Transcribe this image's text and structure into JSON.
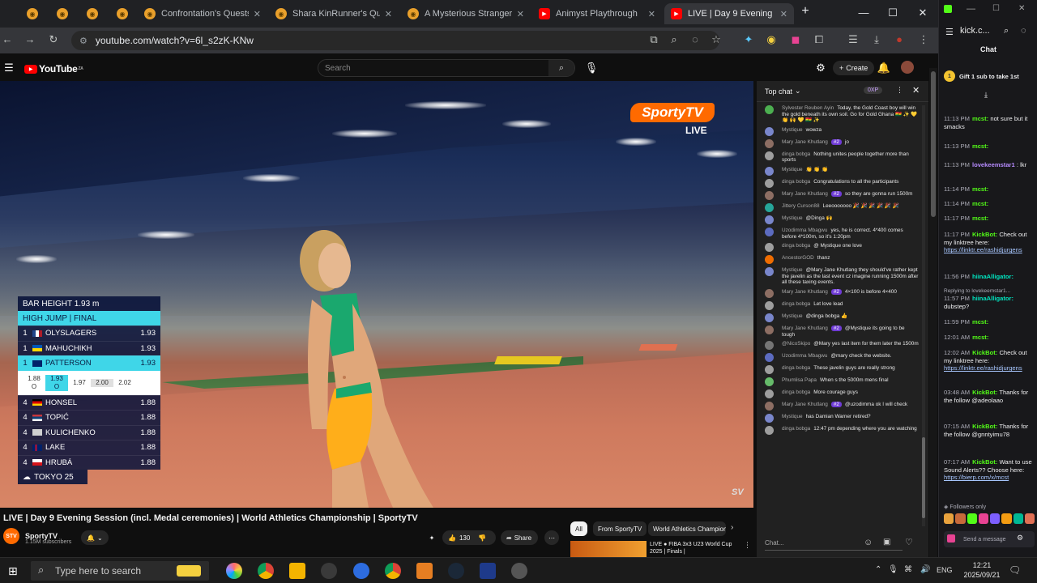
{
  "browser": {
    "tabs": [
      {
        "label": "",
        "pinned": true
      },
      {
        "label": "",
        "pinned": true
      },
      {
        "label": "",
        "pinned": true
      },
      {
        "label": "",
        "pinned": true
      },
      {
        "label": "Confrontation's Quests"
      },
      {
        "label": "Shara KinRunner's Quest"
      },
      {
        "label": "A Mysterious Stranger's"
      },
      {
        "label": "Animyst Playthrough"
      },
      {
        "label": "LIVE | Day 9 Evening",
        "active": true
      }
    ],
    "url": "youtube.com/watch?v=6l_s2zK-KNw"
  },
  "youtube": {
    "logo": "YouTube",
    "region": "ZA",
    "search_placeholder": "Search",
    "create_label": "Create",
    "video": {
      "broadcaster_logo": "SportyTV",
      "live_label": "LIVE",
      "corner_logo": "SV",
      "scoreboard": {
        "bar_height": "BAR HEIGHT 1.93 m",
        "event": "HIGH JUMP | FINAL",
        "rows": [
          {
            "rank": "1",
            "name": "OLYSLAGERS",
            "height": "1.93"
          },
          {
            "rank": "1",
            "name": "MAHUCHIKH",
            "height": "1.93"
          },
          {
            "rank": "1",
            "name": "PATTERSON",
            "height": "1.93",
            "highlight": true
          },
          {
            "rank": "4",
            "name": "HONSEL",
            "height": "1.88"
          },
          {
            "rank": "4",
            "name": "TOPIĆ",
            "height": "1.88"
          },
          {
            "rank": "4",
            "name": "KULICHENKO",
            "height": "1.88"
          },
          {
            "rank": "4",
            "name": "LAKE",
            "height": "1.88"
          },
          {
            "rank": "4",
            "name": "HRUBÁ",
            "height": "1.88"
          }
        ],
        "attempts": [
          {
            "height": "1.88",
            "mark": "O"
          },
          {
            "height": "1.93",
            "mark": "O"
          },
          {
            "height": "1.97",
            "mark": ""
          },
          {
            "height": "2.00",
            "mark": ""
          },
          {
            "height": "2.02",
            "mark": ""
          }
        ],
        "footer": "TOKYO 25"
      }
    },
    "title": "LIVE | Day 9 Evening Session (incl. Medal ceremonies) | World Athletics Championship | SportyTV",
    "channel": {
      "name": "SportyTV",
      "subscribers": "1.15M subscribers",
      "avatar_text": "STV"
    },
    "likes": "130",
    "share_label": "Share",
    "chips": [
      "All",
      "From SportyTV",
      "World Athletics Champion"
    ],
    "recommended": {
      "title": "LIVE ● FIBA 3x3 U23 World Cup 2025 | Finals |"
    },
    "chat": {
      "header": "Top chat",
      "points": "0XP",
      "input_placeholder": "Chat...",
      "messages": [
        {
          "author": "Sylvester Reuben Ayin",
          "text": "Today, the Gold Coast boy will win the gold beneath its own soil. Go for Gold Ghana 🇬🇭 ✨ 💛 👏 🙌 💛 🇬🇭 ✨",
          "color": "#4caf50"
        },
        {
          "author": "Mystique",
          "text": "wowza",
          "color": "#7986cb"
        },
        {
          "author": "Mary Jane Khutlang",
          "badge": "#2",
          "text": "jo",
          "color": "#8d6e63"
        },
        {
          "author": "dinga bobga",
          "text": "Nothing unites people together more than sports",
          "color": "#9e9e9e"
        },
        {
          "author": "Mystique",
          "text": "👏 👏 👏",
          "color": "#7986cb"
        },
        {
          "author": "dinga bobga",
          "text": "Congratulations to all the participants",
          "color": "#9e9e9e"
        },
        {
          "author": "Mary Jane Khutlang",
          "badge": "#2",
          "text": "so they are gonna run 1500m",
          "color": "#8d6e63"
        },
        {
          "author": "Jittery Curson88",
          "text": "Leeooooooo 🎉 🎉 🎉 🎉 🎉 🎉",
          "color": "#26a69a"
        },
        {
          "author": "Mystique",
          "text": "@Dinga 🙌",
          "color": "#7986cb"
        },
        {
          "author": "Uzodimma Mbagwu",
          "text": "yes, he is correct. 4*400 comes before 4*100m, so it's 1:20pm",
          "color": "#5c6bc0"
        },
        {
          "author": "dinga bobga",
          "text": "@ Mystique one love",
          "color": "#9e9e9e"
        },
        {
          "author": "AncestorGOD",
          "text": "thanz",
          "color": "#ef6c00"
        },
        {
          "author": "Mystique",
          "text": "@Mary Jane Khutlang they should've rather kept the javelin as the last event cz imagine running 1500m after all these taxing events.",
          "color": "#7986cb"
        },
        {
          "author": "Mary Jane Khutlang",
          "badge": "#2",
          "text": "4×100 is before 4×400",
          "color": "#8d6e63"
        },
        {
          "author": "dinga bobga",
          "text": "Let love lead",
          "color": "#9e9e9e"
        },
        {
          "author": "Mystique",
          "text": "@dinga bobga 👍",
          "color": "#7986cb"
        },
        {
          "author": "Mary Jane Khutlang",
          "badge": "#2",
          "text": "@Mystique its going to be tough",
          "color": "#8d6e63"
        },
        {
          "author": "@NicoSkipo",
          "text": "@Mary yes last item for them later the 1500m",
          "color": "#757575"
        },
        {
          "author": "Uzodimma Mbagwu",
          "text": "@mary check the website.",
          "color": "#5c6bc0"
        },
        {
          "author": "dinga bobga",
          "text": "These javelin guys are really strong",
          "color": "#9e9e9e"
        },
        {
          "author": "Phumlisa Papa",
          "text": "When s the 5000m mens final",
          "color": "#66bb6a"
        },
        {
          "author": "dinga bobga",
          "text": "More courage guys",
          "color": "#9e9e9e"
        },
        {
          "author": "Mary Jane Khutlang",
          "badge": "#2",
          "text": "@uzodimma ok I will check",
          "color": "#8d6e63"
        },
        {
          "author": "Mystique",
          "text": "has Damian Warner retired?",
          "color": "#7986cb"
        },
        {
          "author": "dinga bobga",
          "text": "12:47 pm depending where you are watching",
          "color": "#9e9e9e"
        }
      ]
    }
  },
  "kick": {
    "url": "kick.c...",
    "chat_label": "Chat",
    "pinned": "Gift 1 sub to take 1st",
    "followers_only": "Followers only",
    "send_label": "Send a message",
    "messages": [
      {
        "time": "11:13 PM",
        "author": "mcst:",
        "text": "not sure but it smacks",
        "cls": ""
      },
      {
        "time": "11:13 PM",
        "author": "mcst:",
        "text": "",
        "cls": ""
      },
      {
        "time": "11:13 PM",
        "author": "lovekeemstar1",
        "text": ": lkr",
        "cls": "p"
      },
      {
        "time": "11:14 PM",
        "author": "mcst:",
        "text": "",
        "cls": ""
      },
      {
        "time": "11:14 PM",
        "author": "mcst:",
        "text": "",
        "cls": ""
      },
      {
        "time": "11:17 PM",
        "author": "mcst:",
        "text": "",
        "cls": ""
      },
      {
        "time": "11:17 PM",
        "author": "KickBot:",
        "text": "Check out my linktree here:",
        "link": "https://linktr.ee/rashidjurgens",
        "cls": ""
      },
      {
        "time": "11:56 PM",
        "author": "hiinaAlligator:",
        "text": "",
        "cls": "g"
      },
      {
        "time": "",
        "author": "",
        "text": "Replying to lovekeemstar1...",
        "cls": ""
      },
      {
        "time": "11:57 PM",
        "author": "hiinaAlligator:",
        "text": "dubstep?",
        "cls": "g"
      },
      {
        "time": "11:59 PM",
        "author": "mcst:",
        "text": "",
        "cls": ""
      },
      {
        "time": "12:01 AM",
        "author": "mcst:",
        "text": "",
        "cls": ""
      },
      {
        "time": "12:02 AM",
        "author": "KickBot:",
        "text": "Check out my linktree here:",
        "link": "https://linktr.ee/rashidjurgens",
        "cls": ""
      },
      {
        "time": "03:48 AM",
        "author": "KickBot:",
        "text": "Thanks for the follow @adeolaao",
        "cls": ""
      },
      {
        "time": "07:15 AM",
        "author": "KickBot:",
        "text": "Thanks for the follow @gnntyimu78",
        "cls": ""
      },
      {
        "time": "07:17 AM",
        "author": "KickBot:",
        "text": "Want to use Sound Alerts?? Choose here:",
        "link": "https://bierp.com/x/mcst",
        "cls": ""
      }
    ]
  },
  "taskbar": {
    "search_placeholder": "Type here to search",
    "language": "ENG",
    "time": "12:21",
    "date": "2025/09/21"
  }
}
